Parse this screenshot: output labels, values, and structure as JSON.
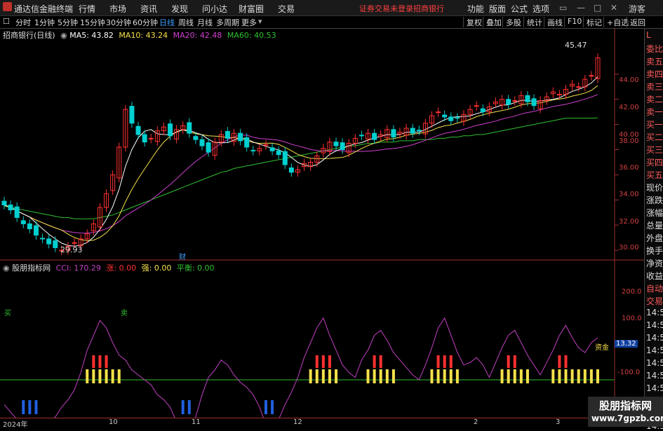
{
  "app": {
    "title": "通达信金融终端",
    "login_hint": "证券交易未登录",
    "security_name": "招商银行",
    "user": "游客"
  },
  "menu": [
    "行情",
    "市场",
    "资讯",
    "发现",
    "问小达",
    "财富圈",
    "交易"
  ],
  "menu_right": [
    "功能",
    "版面",
    "公式",
    "选项"
  ],
  "periods": [
    "分时",
    "1分钟",
    "5分钟",
    "15分钟",
    "30分钟",
    "60分钟",
    "日线",
    "周线",
    "月线",
    "多周期",
    "更多"
  ],
  "active_period": "日线",
  "toolbar_right": [
    "复权",
    "叠加",
    "多股",
    "统计",
    "画线",
    "F10",
    "标记",
    "+自选",
    "返回"
  ],
  "main_legend": {
    "name": "招商银行(日线)",
    "ma5": "MA5: 43.82",
    "ma10": "MA10: 43.24",
    "ma20": "MA20: 42.48",
    "ma60": "MA60: 40.53"
  },
  "price_axis": [
    "44.00",
    "42.00",
    "40.00",
    "38.00",
    "36.00",
    "34.00",
    "32.00",
    "30.00"
  ],
  "price_labels": {
    "high": "45.47",
    "low": "29.93",
    "event": "财"
  },
  "indicator_legend": {
    "name": "股朋指标网",
    "cci": "CCI: 170.29",
    "zhang": "涨: 0.00",
    "qiang": "强: 0.00",
    "pingheng": "平衡: 0.00"
  },
  "indicator_axis": [
    "200.0",
    "100.0",
    "-100.0"
  ],
  "indicator_markers": {
    "buy": "买",
    "sell": "卖",
    "value": "13.32",
    "tag": "资金"
  },
  "date_labels": [
    "2024年",
    "10",
    "11",
    "12",
    "2",
    "3"
  ],
  "right_panel": [
    "L",
    "委比",
    "卖五",
    "卖四",
    "卖三",
    "卖二",
    "卖一",
    "买一",
    "买二",
    "买三",
    "买四",
    "买五",
    "现价",
    "涨跌",
    "涨幅",
    "总量",
    "外盘",
    "换手",
    "净资",
    "收益",
    "自动",
    "交易",
    "14:56",
    "14:56",
    "14:56",
    "14:56",
    "14:56",
    "14:56",
    "14:56",
    "14:56",
    "14:56",
    "14:56"
  ],
  "watermark": {
    "line1": "股朋指标网",
    "line2": "www.7gpzb.com"
  },
  "colors": {
    "up": "#ff3030",
    "down": "#00d0d0",
    "ma5": "#ffffff",
    "ma10": "#f5e04a",
    "ma20": "#d040d0",
    "ma60": "#30c030",
    "cci": "#c040c0"
  },
  "chart_data": {
    "type": "candlestick",
    "closes": [
      33.6,
      33.2,
      32.6,
      32.1,
      31.7,
      31.2,
      30.9,
      30.5,
      30.2,
      30.0,
      30.3,
      30.6,
      30.9,
      31.3,
      32.1,
      33.4,
      34.5,
      36.0,
      38.2,
      41.2,
      40.1,
      39.2,
      38.6,
      38.9,
      39.5,
      39.8,
      39.1,
      39.6,
      39.9,
      39.3,
      38.8,
      38.3,
      37.8,
      38.6,
      39.2,
      38.9,
      39.3,
      38.7,
      38.2,
      37.9,
      38.1,
      38.4,
      37.9,
      37.6,
      36.8,
      36.2,
      36.4,
      36.9,
      37.0,
      37.5,
      38.1,
      38.6,
      38.3,
      38.0,
      38.5,
      38.9,
      39.1,
      39.3,
      38.8,
      39.2,
      39.6,
      39.0,
      39.4,
      39.7,
      39.3,
      39.5,
      40.1,
      40.7,
      41.0,
      40.6,
      40.3,
      40.5,
      40.8,
      41.2,
      41.5,
      41.0,
      41.4,
      41.8,
      42.0,
      41.6,
      41.9,
      42.3,
      41.8,
      41.5,
      41.9,
      42.2,
      42.6,
      42.4,
      42.8,
      43.2,
      43.0,
      43.6,
      43.9,
      45.3
    ],
    "ma60": [
      33.5,
      33.4,
      33.3,
      33.2,
      33.1,
      33.0,
      32.9,
      32.8,
      32.7,
      32.6,
      32.6,
      32.5,
      32.5,
      32.5,
      32.5,
      32.6,
      32.7,
      32.8,
      33.0,
      33.2,
      33.4,
      33.6,
      33.8,
      34.0,
      34.2,
      34.4,
      34.6,
      34.8,
      35.0,
      35.2,
      35.4,
      35.6,
      35.8,
      36.0,
      36.2,
      36.3,
      36.5,
      36.6,
      36.7,
      36.8,
      36.9,
      37.0,
      37.1,
      37.2,
      37.3,
      37.4,
      37.5,
      37.6,
      37.7,
      37.8,
      37.9,
      38.0,
      38.1,
      38.2,
      38.3,
      38.3,
      38.4,
      38.5,
      38.5,
      38.6,
      38.6,
      38.6,
      38.7,
      38.7,
      38.7,
      38.8,
      38.8,
      38.8,
      38.9,
      38.9,
      39.0,
      39.0,
      39.1,
      39.1,
      39.2,
      39.2,
      39.3,
      39.4,
      39.5,
      39.6,
      39.7,
      39.8,
      39.9,
      40.0,
      40.1,
      40.2,
      40.3,
      40.4,
      40.5,
      40.5,
      40.5,
      40.5,
      40.5,
      40.53
    ],
    "cci": [
      -100,
      -130,
      -160,
      -200,
      -230,
      -190,
      -160,
      -170,
      -150,
      -110,
      -80,
      -40,
      30,
      120,
      180,
      240,
      210,
      150,
      100,
      80,
      40,
      20,
      0,
      -20,
      -60,
      -80,
      -110,
      -170,
      -250,
      -200,
      -150,
      -60,
      10,
      40,
      80,
      60,
      20,
      -10,
      -30,
      -60,
      -110,
      -180,
      -210,
      -160,
      -100,
      -50,
      10,
      90,
      150,
      210,
      250,
      180,
      120,
      60,
      30,
      10,
      80,
      120,
      180,
      200,
      160,
      110,
      80,
      50,
      20,
      0,
      60,
      130,
      210,
      250,
      180,
      110,
      60,
      70,
      90,
      60,
      10,
      70,
      130,
      180,
      200,
      150,
      100,
      60,
      20,
      70,
      120,
      180,
      220,
      170,
      130,
      110,
      150,
      170
    ],
    "price_range": [
      29.5,
      46.5
    ],
    "cci_range": [
      -300,
      300
    ]
  }
}
